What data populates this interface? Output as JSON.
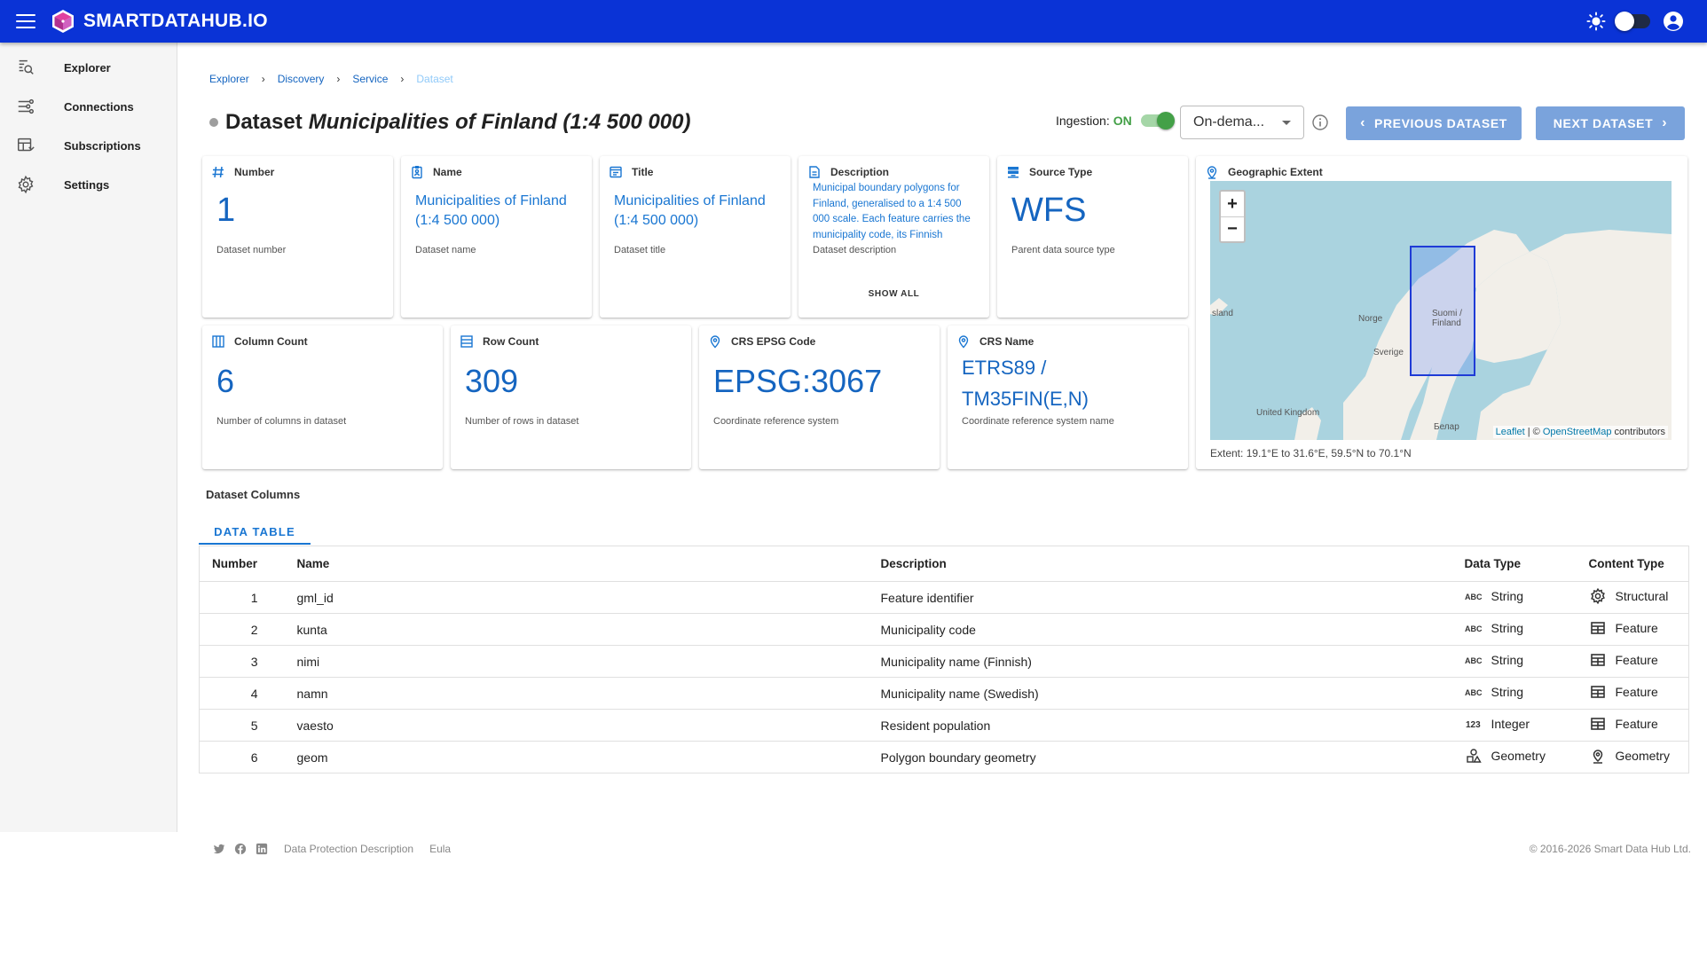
{
  "topbar": {
    "brand": "SMARTDATAHUB.IO",
    "menu_icon": "menu-icon",
    "theme_icon": "sun-icon",
    "account_icon": "account-circle-icon"
  },
  "sidebar": {
    "items": [
      {
        "label": "Explorer",
        "icon": "search-data-icon"
      },
      {
        "label": "Connections",
        "icon": "connections-icon"
      },
      {
        "label": "Subscriptions",
        "icon": "subscriptions-icon"
      },
      {
        "label": "Settings",
        "icon": "gear-icon"
      }
    ]
  },
  "breadcrumb": {
    "items": [
      "Explorer",
      "Discovery",
      "Service"
    ],
    "current": "Dataset"
  },
  "header": {
    "prefix": "Dataset",
    "name": "Municipalities of Finland (1:4 500 000)",
    "ingestion_label": "Ingestion:",
    "ingestion_state": "ON",
    "ingestion_enabled": true,
    "mode": "On-dema...",
    "prev_label": "PREVIOUS DATASET",
    "next_label": "NEXT DATASET"
  },
  "cards": {
    "number": {
      "title": "Number",
      "value": "1",
      "sub": "Dataset number"
    },
    "name": {
      "title": "Name",
      "value": "Municipalities of Finland (1:4 500 000)",
      "sub": "Dataset name"
    },
    "title": {
      "title": "Title",
      "value": "Municipalities of Finland (1:4 500 000)",
      "sub": "Dataset title"
    },
    "description": {
      "title": "Description",
      "value": "Municipal boundary polygons for Finland, generalised to a 1:4 500 000 scale. Each feature carries the municipality code, its Finnish",
      "sub": "Dataset description",
      "show_all": "SHOW ALL"
    },
    "source_type": {
      "title": "Source Type",
      "value": "WFS",
      "sub": "Parent data source type"
    },
    "column_count": {
      "title": "Column Count",
      "value": "6",
      "sub": "Number of columns in dataset"
    },
    "row_count": {
      "title": "Row Count",
      "value": "309",
      "sub": "Number of rows in dataset"
    },
    "crs_epsg": {
      "title": "CRS EPSG Code",
      "value": "EPSG:3067",
      "sub": "Coordinate reference system"
    },
    "crs_name": {
      "title": "CRS Name",
      "value": "ETRS89 / TM35FIN(E,N)",
      "sub": "Coordinate reference system name"
    },
    "extent": {
      "title": "Geographic Extent",
      "labels": {
        "iceland": "sland",
        "norway": "Norge",
        "finland": "Suomi / Finland",
        "sweden": "Sverige",
        "uk": "United Kingdom",
        "belarus": "Белар"
      },
      "zoom_in": "+",
      "zoom_out": "−",
      "attribution": {
        "leaflet": "Leaflet",
        "sep": " | © ",
        "osm": "OpenStreetMap",
        "tail": " contributors"
      },
      "extent_text": "Extent: 19.1°E to 31.6°E, 59.5°N to 70.1°N"
    }
  },
  "columns_section": {
    "title": "Dataset Columns",
    "tab": "DATA TABLE",
    "headers": [
      "Number",
      "Name",
      "Description",
      "Data Type",
      "Content Type"
    ],
    "rows": [
      {
        "number": "1",
        "name": "gml_id",
        "description": "Feature identifier",
        "data_type": "String",
        "data_icon": "abc-icon",
        "content_type": "Structural",
        "content_icon": "gear-icon"
      },
      {
        "number": "2",
        "name": "kunta",
        "description": "Municipality code",
        "data_type": "String",
        "data_icon": "abc-icon",
        "content_type": "Feature",
        "content_icon": "table-icon"
      },
      {
        "number": "3",
        "name": "nimi",
        "description": "Municipality name (Finnish)",
        "data_type": "String",
        "data_icon": "abc-icon",
        "content_type": "Feature",
        "content_icon": "table-icon"
      },
      {
        "number": "4",
        "name": "namn",
        "description": "Municipality name (Swedish)",
        "data_type": "String",
        "data_icon": "abc-icon",
        "content_type": "Feature",
        "content_icon": "table-icon"
      },
      {
        "number": "5",
        "name": "vaesto",
        "description": "Resident population",
        "data_type": "Integer",
        "data_icon": "123-icon",
        "content_type": "Feature",
        "content_icon": "table-icon"
      },
      {
        "number": "6",
        "name": "geom",
        "description": "Polygon boundary geometry",
        "data_type": "Geometry",
        "data_icon": "shapes-icon",
        "content_type": "Geometry",
        "content_icon": "pin-icon"
      }
    ]
  },
  "footer": {
    "links": [
      "Data Protection Description",
      "Eula"
    ],
    "copyright": "© 2016-2026 Smart Data Hub Ltd.",
    "social_icons": [
      "twitter-icon",
      "facebook-icon",
      "linkedin-icon"
    ]
  }
}
